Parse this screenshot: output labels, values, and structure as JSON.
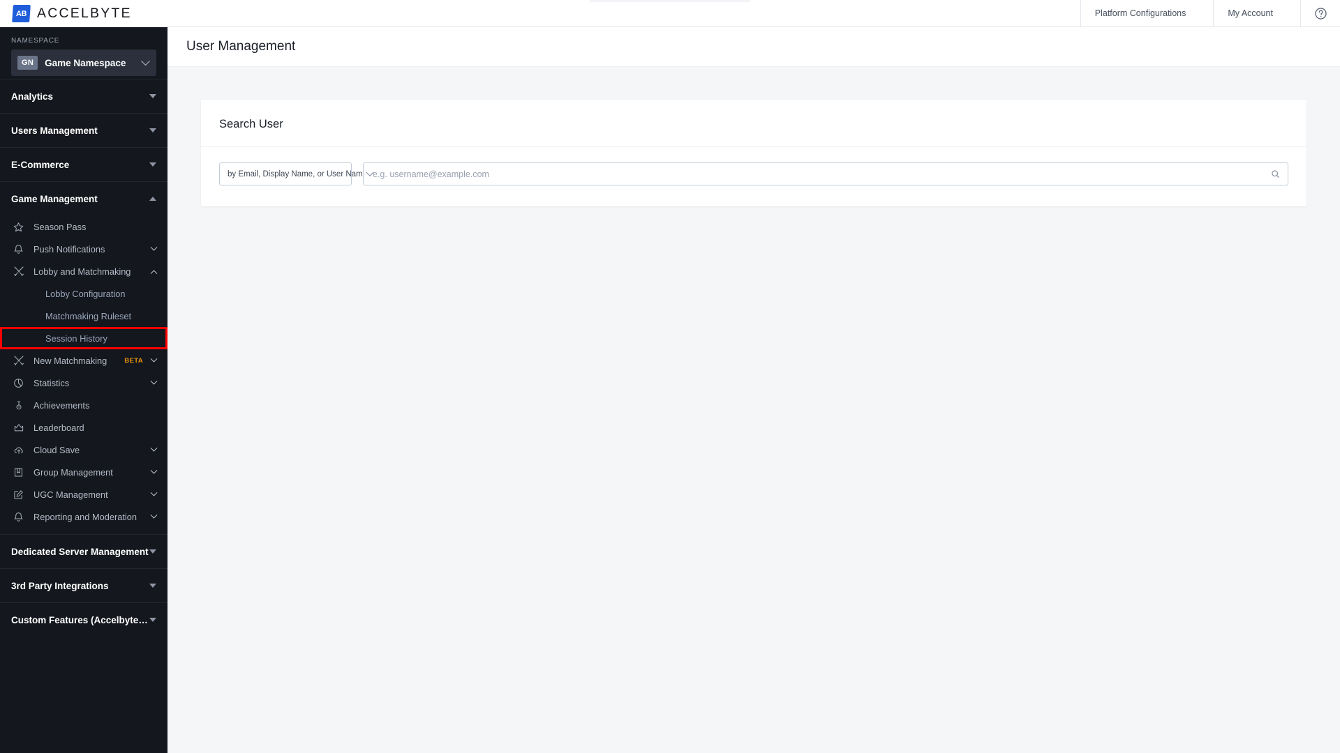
{
  "topbar": {
    "brand_mark": "accelbyte-logo-icon",
    "brand_text": "ACCELBYTE",
    "platform_configurations": "Platform Configurations",
    "my_account": "My Account",
    "help": "?"
  },
  "sidebar": {
    "namespace_label": "NAMESPACE",
    "namespace_badge": "GN",
    "namespace_name": "Game Namespace",
    "sections": [
      {
        "title": "Analytics",
        "expanded": false
      },
      {
        "title": "Users Management",
        "expanded": false
      },
      {
        "title": "E-Commerce",
        "expanded": false
      },
      {
        "title": "Game Management",
        "expanded": true
      },
      {
        "title": "Dedicated Server Management",
        "expanded": false
      },
      {
        "title": "3rd Party Integrations",
        "expanded": false
      },
      {
        "title": "Custom Features (Accelbyte In...",
        "expanded": false
      }
    ],
    "game_management_items": [
      {
        "label": "Season Pass",
        "icon": "star-icon",
        "chevron": false
      },
      {
        "label": "Push Notifications",
        "icon": "bell-icon",
        "chevron": true
      },
      {
        "label": "Lobby and Matchmaking",
        "icon": "swords-icon",
        "chevron": true,
        "chevron_up": true
      },
      {
        "label": "New Matchmaking",
        "icon": "swords-icon",
        "chevron": true,
        "badge": "BETA"
      },
      {
        "label": "Statistics",
        "icon": "pie-chart-icon",
        "chevron": true
      },
      {
        "label": "Achievements",
        "icon": "medal-icon",
        "chevron": false
      },
      {
        "label": "Leaderboard",
        "icon": "crown-icon",
        "chevron": false
      },
      {
        "label": "Cloud Save",
        "icon": "cloud-upload-icon",
        "chevron": true
      },
      {
        "label": "Group Management",
        "icon": "group-banner-icon",
        "chevron": true
      },
      {
        "label": "UGC Management",
        "icon": "edit-square-icon",
        "chevron": true
      },
      {
        "label": "Reporting and Moderation",
        "icon": "bell-icon",
        "chevron": true
      }
    ],
    "lobby_subitems": [
      {
        "label": "Lobby Configuration",
        "highlighted": false
      },
      {
        "label": "Matchmaking Ruleset",
        "highlighted": false
      },
      {
        "label": "Session History",
        "highlighted": true
      }
    ],
    "highlight_color": "#ff0000"
  },
  "main": {
    "page_title": "User Management",
    "card": {
      "title": "Search User",
      "filter_selected": "by Email, Display Name, or User Name",
      "filter_options": [
        "by Email, Display Name, or User Name"
      ],
      "search_value": "",
      "search_placeholder": "e.g. username@example.com",
      "search_icon": "search-icon"
    }
  }
}
